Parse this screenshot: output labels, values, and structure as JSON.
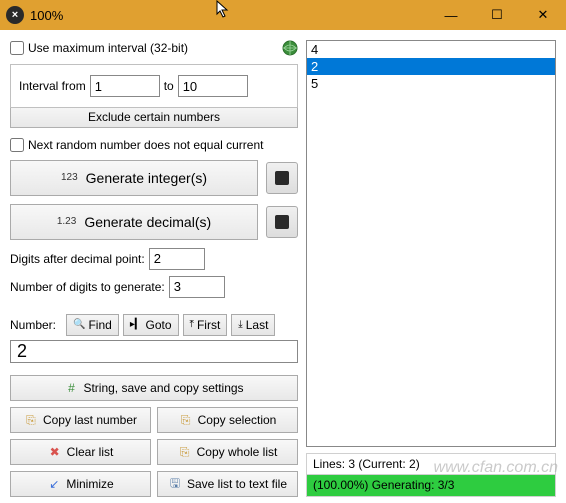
{
  "window": {
    "title": "100%",
    "btn_min": "—",
    "btn_max": "☐",
    "btn_close": "✕",
    "icon_glyph": "×"
  },
  "cb_max_interval": "Use maximum interval (32-bit)",
  "interval": {
    "from_label": "Interval from",
    "from_val": "1",
    "to_label": "to",
    "to_val": "10"
  },
  "exclude_btn": "Exclude certain numbers",
  "cb_not_equal": "Next random number does not equal current",
  "gen_int": {
    "prefix": "123",
    "label": "Generate integer(s)"
  },
  "gen_dec": {
    "prefix": "1.23",
    "label": "Generate decimal(s)"
  },
  "digits_after": {
    "label": "Digits after decimal point:",
    "val": "2"
  },
  "num_digits": {
    "label": "Number of digits to generate:",
    "val": "3"
  },
  "number_label": "Number:",
  "nav": {
    "find": "Find",
    "goto": "Goto",
    "first": "First",
    "last": "Last"
  },
  "number_val": "2",
  "bottom": {
    "string_settings": "String, save and copy settings",
    "copy_last": "Copy last number",
    "copy_sel": "Copy selection",
    "clear_list": "Clear list",
    "copy_whole": "Copy whole list",
    "minimize": "Minimize",
    "save_txt": "Save list to text file"
  },
  "results": [
    "4",
    "2",
    "5"
  ],
  "selected_index": 1,
  "status_lines": "Lines: 3 (Current: 2)",
  "status_gen": "(100.00%) Generating: 3/3",
  "progress_pct": 100,
  "watermark": "www.cfan.com.cn"
}
